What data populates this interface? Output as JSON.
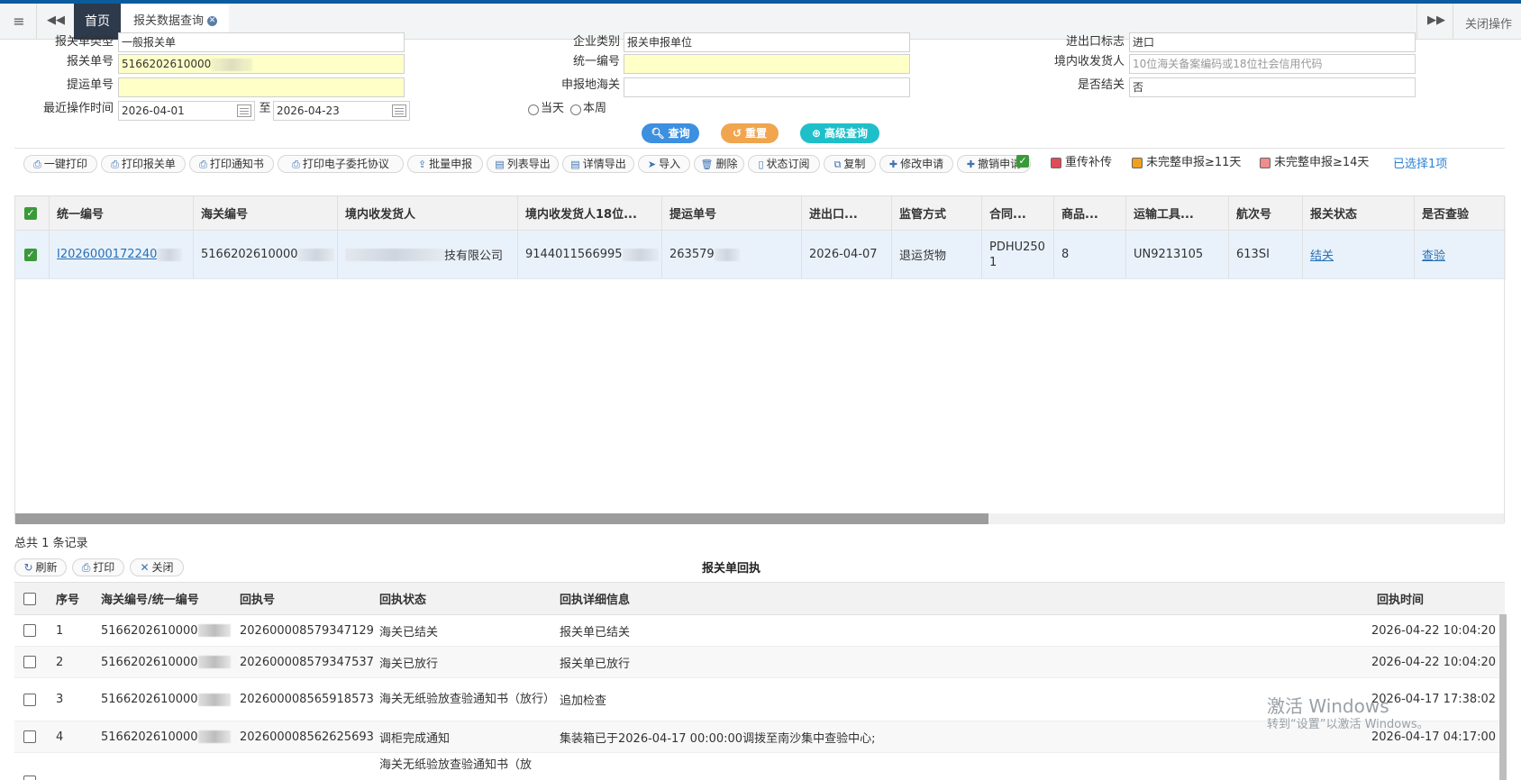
{
  "tabs": {
    "home": "首页",
    "current": "报关数据查询",
    "close_ops": "关闭操作"
  },
  "form": {
    "decl_type_label": "报关单类型",
    "decl_type_value": "一般报关单",
    "enterprise_identity_label": "企业类别",
    "enterprise_identity_value": "报关申报单位",
    "ie_flag_label": "进出口标志",
    "ie_flag_value": "进口",
    "decl_no_label": "报关单号",
    "decl_no_value": "5166202610000",
    "unified_no_label": "统一编号",
    "unified_no_value": "",
    "consignee_label": "境内收发货人",
    "consignee_placeholder": "10位海关备案编码或18位社会信用代码",
    "bl_no_label": "提运单号",
    "bl_no_value": "",
    "decl_customs_label": "申报地海关",
    "decl_customs_value": "",
    "closed_label": "是否结关",
    "closed_value": "否",
    "recent_time_label": "最近操作时间",
    "date_from": "2026-04-01",
    "date_to_label": "至",
    "date_to": "2026-04-23",
    "radio_today": "当天",
    "radio_week": "本周"
  },
  "actions": {
    "query": "查询",
    "reset": "重置",
    "advanced": "高级查询"
  },
  "colors": {
    "query": "#3d8fe0",
    "reset": "#f0a54e",
    "advanced": "#1fbfc9",
    "legend_resend": "#e04b59",
    "legend_11": "#f0a020",
    "legend_14": "#f08c8c"
  },
  "toolbar": [
    {
      "label": "一键打印",
      "icon": "print-icon"
    },
    {
      "label": "打印报关单",
      "icon": "print-icon"
    },
    {
      "label": "打印通知书",
      "icon": "print-icon"
    },
    {
      "label": "打印电子委托协议",
      "icon": "print-icon"
    },
    {
      "label": "批量申报",
      "icon": "upload-icon"
    },
    {
      "label": "列表导出",
      "icon": "export-icon"
    },
    {
      "label": "详情导出",
      "icon": "export-icon"
    },
    {
      "label": "导入",
      "icon": "send-icon"
    },
    {
      "label": "删除",
      "icon": "trash-icon"
    },
    {
      "label": "状态订阅",
      "icon": "phone-icon"
    },
    {
      "label": "复制",
      "icon": "copy-icon"
    },
    {
      "label": "修改申请",
      "icon": "plus-icon"
    },
    {
      "label": "撤销申请",
      "icon": "plus-icon"
    }
  ],
  "legend": {
    "resend": "重传补传",
    "incomplete_11": "未完整申报≥11天",
    "incomplete_14": "未完整申报≥14天",
    "selected": "已选择1项"
  },
  "grid1": {
    "headers": [
      "统一编号",
      "海关编号",
      "境内收发货人",
      "境内收发货人18位...",
      "提运单号",
      "进出口...",
      "监管方式",
      "合同...",
      "商品...",
      "运输工具...",
      "航次号",
      "报关状态",
      "是否查验"
    ],
    "row": {
      "unified_no": "I2026000172240",
      "customs_no": "5166202610000",
      "consignee": "技有限公司",
      "consignee_code": "9144011566995",
      "bl_no": "263579",
      "ie_date": "2026-04-07",
      "supervision": "退运货物",
      "contract": "PDHU2501",
      "goods": "8",
      "transport": "UN9213105",
      "voyage": "613SI",
      "status": "结关",
      "inspection": "查验"
    }
  },
  "total": "总共 1 条记录",
  "receipt": {
    "refresh": "刷新",
    "print": "打印",
    "close": "关闭",
    "title": "报关单回执",
    "headers": [
      "序号",
      "海关编号/统一编号",
      "回执号",
      "回执状态",
      "回执详细信息",
      "回执时间"
    ],
    "rows": [
      {
        "seq": "1",
        "no": "5166202610000",
        "receipt_no": "202600008579347129",
        "state": "海关已结关",
        "detail": "报关单已结关",
        "time": "2026-04-22 10:04:20"
      },
      {
        "seq": "2",
        "no": "5166202610000",
        "receipt_no": "202600008579347537",
        "state": "海关已放行",
        "detail": "报关单已放行",
        "time": "2026-04-22 10:04:20"
      },
      {
        "seq": "3",
        "no": "5166202610000",
        "receipt_no": "202600008565918573",
        "state": "海关无纸验放查验通知书（放行）",
        "detail": "追加检查",
        "time": "2026-04-17 17:38:02"
      },
      {
        "seq": "4",
        "no": "5166202610000",
        "receipt_no": "202600008562625693",
        "state": "调柜完成通知",
        "detail": "集装箱已于2026-04-17 00:00:00调拨至南沙集中查验中心;",
        "time": "2026-04-17 04:17:00"
      },
      {
        "seq": "",
        "no": "",
        "receipt_no": "",
        "state": "海关无纸验放查验通知书（放",
        "detail": "",
        "time": ""
      }
    ]
  },
  "watermark": {
    "line1": "激活 Windows",
    "line2": "转到“设置”以激活 Windows。"
  }
}
